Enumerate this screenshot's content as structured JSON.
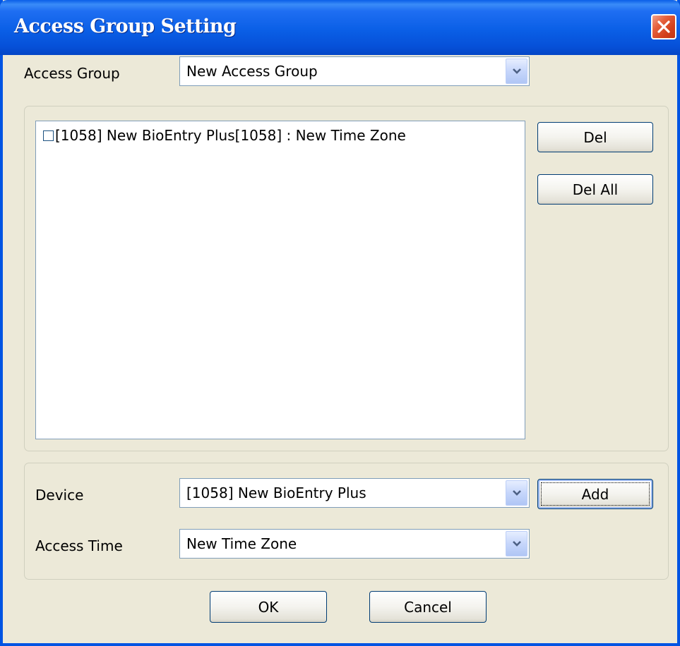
{
  "window": {
    "title": "Access Group Setting"
  },
  "access_group": {
    "label": "Access Group",
    "value": "New Access Group"
  },
  "assignments": {
    "items": [
      {
        "text": "[1058] New BioEntry Plus[1058] : New Time Zone",
        "checked": false
      }
    ],
    "del_label": "Del",
    "del_all_label": "Del All"
  },
  "add_section": {
    "device_label": "Device",
    "device_value": "[1058] New BioEntry Plus",
    "add_label": "Add",
    "access_time_label": "Access Time",
    "access_time_value": "New Time Zone"
  },
  "footer": {
    "ok_label": "OK",
    "cancel_label": "Cancel"
  },
  "colors": {
    "titlebar": "#0a5fe6",
    "dialog_bg": "#ece9d8",
    "close_button": "#d2401c"
  }
}
